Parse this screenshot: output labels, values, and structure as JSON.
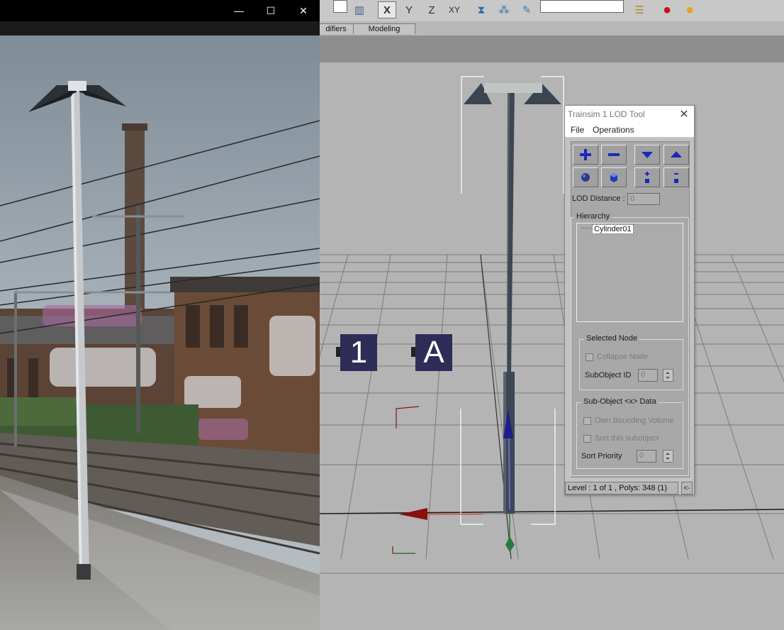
{
  "photo_window": {
    "controls": [
      {
        "name": "minimize-icon",
        "glyph": "—"
      },
      {
        "name": "maximize-icon",
        "glyph": "☐"
      },
      {
        "name": "close-icon",
        "glyph": "✕"
      }
    ]
  },
  "toolbar": {
    "axis_x": "X",
    "axis_y": "Y",
    "axis_z": "Z",
    "axis_xy": "XY",
    "icons": [
      "filter-icon",
      "mirror-icon",
      "array-icon",
      "eraser-icon",
      "layer-icon",
      "material-editor-icon",
      "render-icon"
    ]
  },
  "ribbon": {
    "tabs": [
      "difiers",
      "Modeling"
    ]
  },
  "viewport": {
    "labels": [
      "1",
      "A"
    ],
    "colors": {
      "background": "#b4b4b4",
      "grid": "#7a7a7a",
      "label_bg": "#2e2d57",
      "pole": "#3d4753"
    }
  },
  "lod_tool": {
    "title": "Trainsim 1 LOD Tool",
    "close_glyph": "✕",
    "menu": [
      "File",
      "Operations"
    ],
    "buttons_row1": [
      "add-icon",
      "remove-icon",
      "move-down-icon",
      "move-up-icon"
    ],
    "buttons_row2": [
      "object-icon",
      "object-selected-icon",
      "expand-icon",
      "collapse-icon"
    ],
    "lod_distance_label": "LOD Distance :",
    "lod_distance_value": "0",
    "hierarchy_label": "Hierarchy",
    "tree_item": "Cylinder01",
    "selected_node": {
      "title": "Selected Node",
      "collapse_node": "Collapse Node",
      "subobject_id_label": "SubObject ID",
      "subobject_id_value": "0"
    },
    "subobject_data": {
      "title": "Sub-Object <x> Data",
      "own_bounding_volume": "Own Bounding Volume",
      "sort_this_subobject": "Sort this subobject",
      "sort_priority_label": "Sort Priority",
      "sort_priority_value": "0"
    },
    "status": "Level : 1 of 1 , Polys: 348 (1)",
    "status_button": "<-"
  }
}
